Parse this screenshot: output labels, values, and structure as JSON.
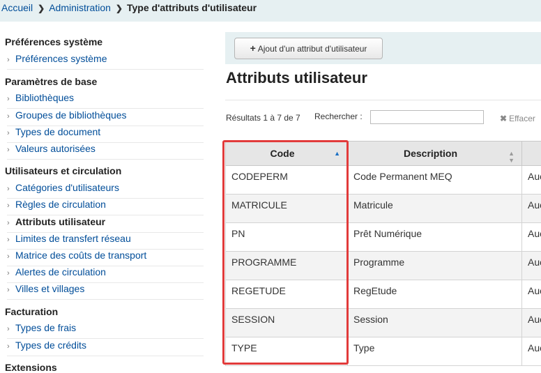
{
  "breadcrumb": {
    "home": "Accueil",
    "admin": "Administration",
    "current": "Type d'attributs d'utilisateur"
  },
  "sidebar": {
    "sections": [
      {
        "title": "Préférences système",
        "items": [
          {
            "label": "Préférences système"
          }
        ]
      },
      {
        "title": "Paramètres de base",
        "items": [
          {
            "label": "Bibliothèques"
          },
          {
            "label": "Groupes de bibliothèques"
          },
          {
            "label": "Types de document"
          },
          {
            "label": "Valeurs autorisées"
          }
        ]
      },
      {
        "title": "Utilisateurs et circulation",
        "items": [
          {
            "label": "Catégories d'utilisateurs"
          },
          {
            "label": "Règles de circulation"
          },
          {
            "label": "Attributs utilisateur",
            "active": true
          },
          {
            "label": "Limites de transfert réseau"
          },
          {
            "label": "Matrice des coûts de transport"
          },
          {
            "label": "Alertes de circulation"
          },
          {
            "label": "Villes et villages"
          }
        ]
      },
      {
        "title": "Facturation",
        "items": [
          {
            "label": "Types de frais"
          },
          {
            "label": "Types de crédits"
          }
        ]
      },
      {
        "title": "Extensions",
        "items": []
      }
    ]
  },
  "toolbar": {
    "add_label": "Ajout d'un attribut d'utilisateur"
  },
  "main": {
    "title": "Attributs utilisateur",
    "results_text": "Résultats 1 à 7 de 7",
    "search_label": "Rechercher :",
    "search_value": "",
    "clear_label": "Effacer"
  },
  "table": {
    "columns": [
      "Code",
      "Description",
      ""
    ],
    "rows": [
      [
        "CODEPERM",
        "Code Permanent MEQ",
        "Auc"
      ],
      [
        "MATRICULE",
        "Matricule",
        "Auc"
      ],
      [
        "PN",
        "Prêt Numérique",
        "Auc"
      ],
      [
        "PROGRAMME",
        "Programme",
        "Auc"
      ],
      [
        "REGETUDE",
        "RegEtude",
        "Auc"
      ],
      [
        "SESSION",
        "Session",
        "Auc"
      ],
      [
        "TYPE",
        "Type",
        "Auc"
      ]
    ]
  },
  "colors": {
    "link": "#004d99",
    "header_bg": "#e6f0f2",
    "highlight": "#e23b3b",
    "sort_active": "#1a6fc4"
  },
  "icons": {
    "breadcrumb_separator": "chevron-right-icon",
    "sidebar_bullet": "chevron-right-icon",
    "add": "plus-icon",
    "clear": "close-icon",
    "sort_asc": "sort-asc-icon",
    "sort_both": "sort-both-icon"
  }
}
